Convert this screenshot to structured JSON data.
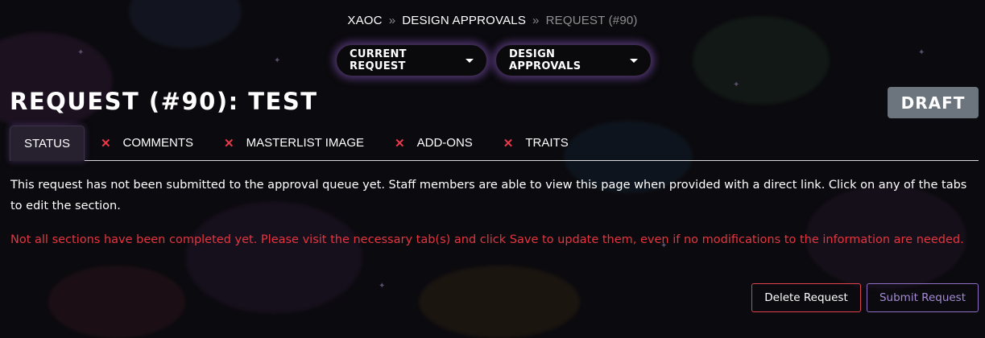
{
  "breadcrumb": {
    "items": [
      "XAOC",
      "DESIGN APPROVALS",
      "REQUEST (#90)"
    ],
    "separator": "»"
  },
  "nav": {
    "current_request_label": "CURRENT REQUEST",
    "design_approvals_label": "DESIGN APPROVALS"
  },
  "page": {
    "title": "REQUEST (#90): TEST",
    "status_badge": "DRAFT"
  },
  "tabs": [
    {
      "label": "STATUS",
      "active": true,
      "incomplete": false
    },
    {
      "label": "COMMENTS",
      "active": false,
      "incomplete": true
    },
    {
      "label": "MASTERLIST IMAGE",
      "active": false,
      "incomplete": true
    },
    {
      "label": "ADD-ONS",
      "active": false,
      "incomplete": true
    },
    {
      "label": "TRAITS",
      "active": false,
      "incomplete": true
    }
  ],
  "content": {
    "info_text": "This request has not been submitted to the approval queue yet. Staff members are able to view this page when provided with a direct link. Click on any of the tabs to edit the section.",
    "warning_text": "Not all sections have been completed yet. Please visit the necessary tab(s) and click Save to update them, even if no modifications to the information are needed."
  },
  "actions": {
    "delete_label": "Delete Request",
    "submit_label": "Submit Request"
  },
  "icons": {
    "incomplete": "x-icon",
    "dropdown": "caret-down-icon"
  },
  "colors": {
    "background": "#0b0a0e",
    "warning": "#e6353f",
    "incomplete_mark": "#e8394a",
    "badge": "#6c757d",
    "glow": "#8c5ac8",
    "submit_outline": "#8e6fc4"
  }
}
